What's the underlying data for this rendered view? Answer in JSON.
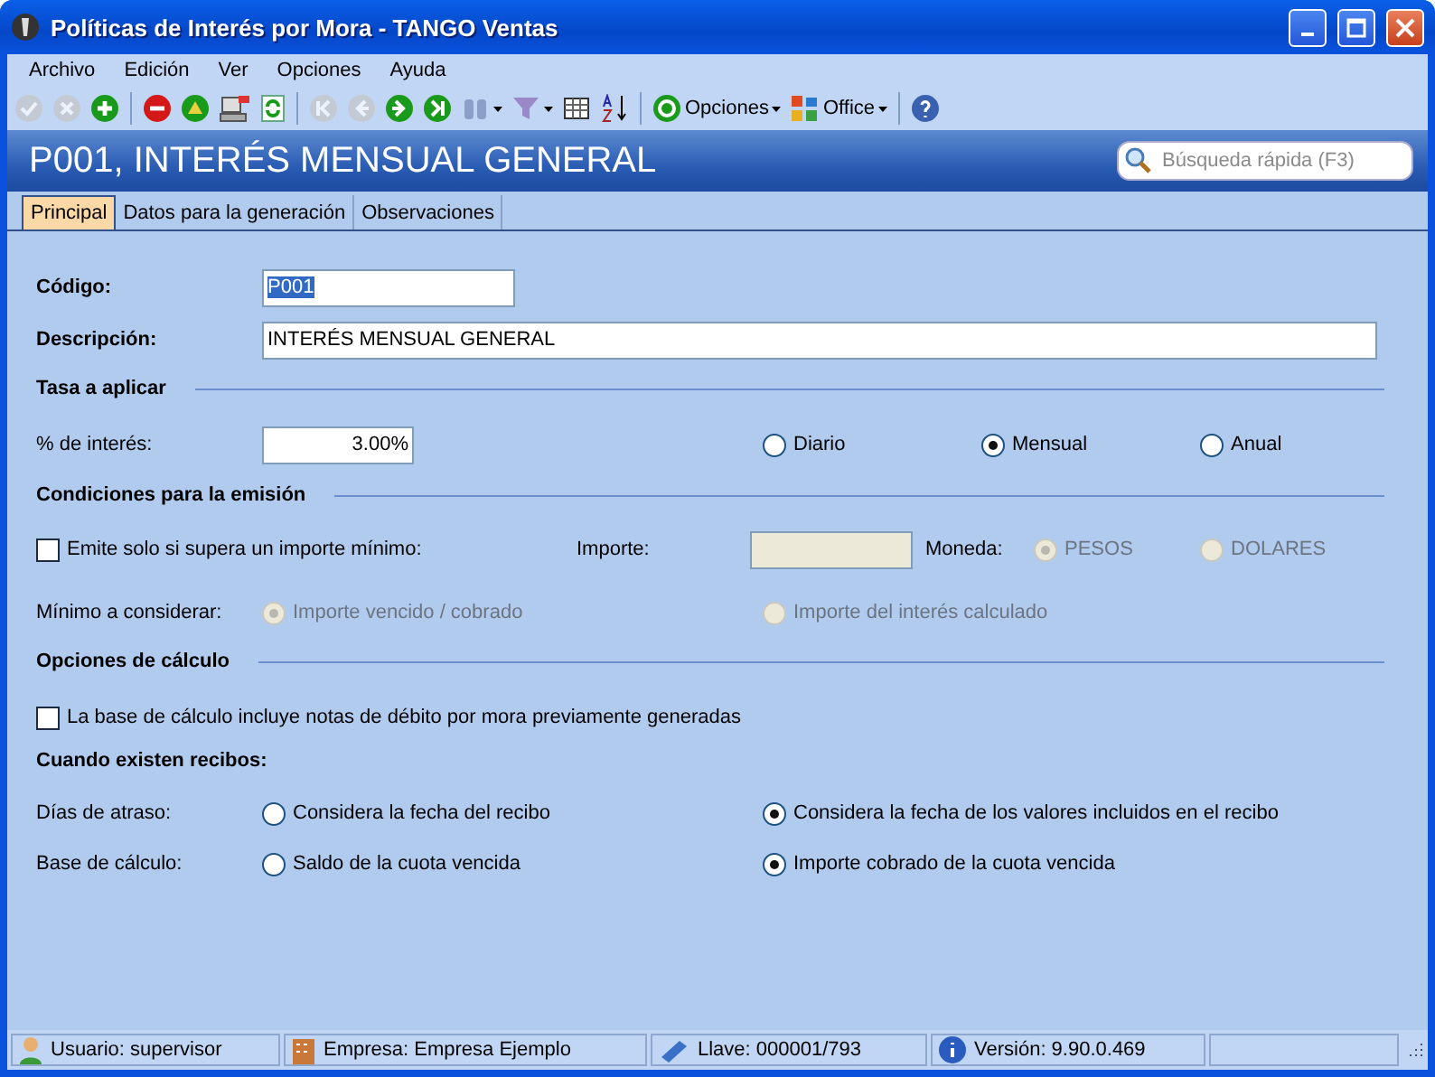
{
  "window": {
    "title": "Políticas de Interés por Mora - TANGO Ventas"
  },
  "menu": [
    "Archivo",
    "Edición",
    "Ver",
    "Opciones",
    "Ayuda"
  ],
  "toolbar": [
    {
      "kind": "button",
      "disabled": true
    },
    {
      "kind": "button",
      "disabled": true
    },
    {
      "kind": "button",
      "disabled": false
    },
    {
      "kind": "separator"
    },
    {
      "kind": "button",
      "disabled": false
    },
    {
      "kind": "button",
      "disabled": false
    },
    {
      "kind": "button",
      "disabled": false
    },
    {
      "kind": "button",
      "disabled": false
    },
    {
      "kind": "separator"
    },
    {
      "kind": "button",
      "disabled": true
    },
    {
      "kind": "button",
      "disabled": true
    },
    {
      "kind": "button",
      "disabled": false
    },
    {
      "kind": "button",
      "disabled": false
    },
    {
      "kind": "split",
      "disabled": false
    },
    {
      "kind": "split",
      "disabled": false
    },
    {
      "kind": "button",
      "disabled": false
    },
    {
      "kind": "button",
      "disabled": false
    },
    {
      "kind": "separator"
    },
    {
      "kind": "menu",
      "label": "Opciones"
    },
    {
      "kind": "menu",
      "label": "Office"
    },
    {
      "kind": "separator"
    },
    {
      "kind": "button",
      "disabled": false
    }
  ],
  "header": {
    "title": "P001, INTERÉS MENSUAL GENERAL",
    "search": {
      "placeholder": "Búsqueda rápida (F3)"
    }
  },
  "tabs": [
    {
      "label": "Principal",
      "selected": true
    },
    {
      "label": "Datos para la generación",
      "selected": false
    },
    {
      "label": "Observaciones",
      "selected": false
    }
  ],
  "form": {
    "codigo": {
      "label": "Código:",
      "value": "P001",
      "highlighted": true
    },
    "descripcion": {
      "label": "Descripción:",
      "value": "INTERÉS MENSUAL GENERAL"
    },
    "tasa": {
      "heading": "Tasa a aplicar",
      "label": "% de interés:",
      "value": "3.00%",
      "periods": [
        {
          "label": "Diario",
          "selected": false
        },
        {
          "label": "Mensual",
          "selected": true
        },
        {
          "label": "Anual",
          "selected": false
        }
      ]
    },
    "condiciones": {
      "heading": "Condiciones para la emisión",
      "minimo_check": {
        "label": "Emite solo si supera un importe mínimo:",
        "checked": false
      },
      "importe": {
        "label": "Importe:",
        "disabled": true
      },
      "moneda": {
        "label": "Moneda:",
        "options": [
          {
            "label": "PESOS",
            "selected": true,
            "disabled": true
          },
          {
            "label": "DOLARES",
            "selected": false,
            "disabled": true
          }
        ]
      },
      "minimo": {
        "label": "Mínimo a considerar:",
        "options": [
          {
            "label": "Importe vencido / cobrado",
            "selected": true,
            "disabled": true
          },
          {
            "label": "Importe del interés calculado",
            "selected": false,
            "disabled": true
          }
        ]
      }
    },
    "calculo": {
      "heading": "Opciones de cálculo",
      "notas_check": {
        "label": "La base de cálculo incluye notas de débito por mora previamente generadas",
        "checked": false
      },
      "recibos_heading": "Cuando existen recibos:",
      "rows": [
        {
          "label": "Días de atraso:",
          "options": [
            {
              "label": "Considera la fecha del recibo",
              "selected": false,
              "disabled": false
            },
            {
              "label": "Considera la fecha de los valores incluidos en el recibo",
              "selected": true,
              "disabled": false
            }
          ]
        },
        {
          "label": "Base de cálculo:",
          "options": [
            {
              "label": "Saldo de la cuota vencida",
              "selected": false,
              "disabled": false
            },
            {
              "label": "Importe cobrado de la cuota vencida",
              "selected": true,
              "disabled": false
            }
          ]
        }
      ]
    }
  },
  "status_bar": [
    {
      "kind": "user",
      "text": "Usuario: supervisor"
    },
    {
      "kind": "company",
      "text": "Empresa: Empresa Ejemplo"
    },
    {
      "kind": "key",
      "text": "Llave: 000001/793"
    },
    {
      "kind": "info",
      "text": "Versión: 9.90.0.469"
    },
    {
      "kind": "empty"
    }
  ]
}
